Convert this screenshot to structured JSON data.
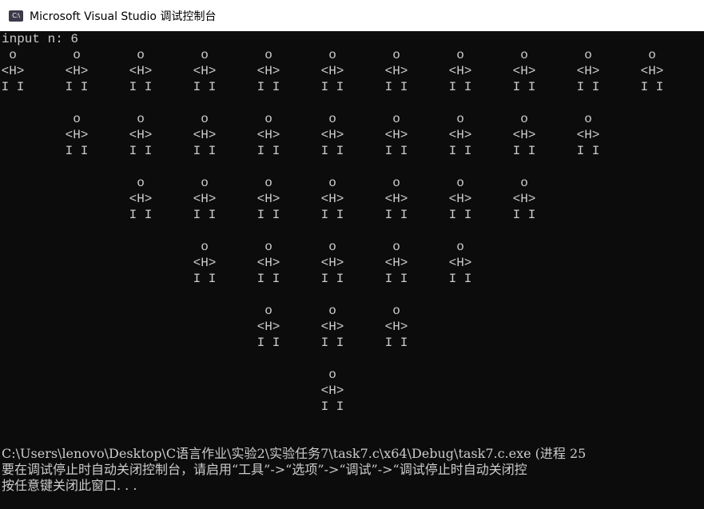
{
  "window": {
    "title": "Microsoft Visual Studio 调试控制台",
    "icon_label": "C:\\"
  },
  "console": {
    "prompt_line": "input n: 6",
    "figure": {
      "head": "o",
      "body": "<H>",
      "legs": "I I"
    },
    "rows": [
      {
        "count": 11
      },
      {
        "count": 9
      },
      {
        "count": 7
      },
      {
        "count": 5
      },
      {
        "count": 3
      },
      {
        "count": 1
      }
    ],
    "footer_lines": [
      "C:\\Users\\lenovo\\Desktop\\C语言作业\\实验2\\实验任务7\\task7.c\\x64\\Debug\\task7.c.exe (进程 25",
      "要在调试停止时自动关闭控制台，请启用“工具”->“选项”->“调试”->“调试停止时自动关闭控",
      "按任意键关闭此窗口. . ."
    ]
  },
  "colors": {
    "console_bg": "#0c0c0c",
    "console_text": "#cccccc",
    "titlebar_bg": "#ffffff"
  }
}
